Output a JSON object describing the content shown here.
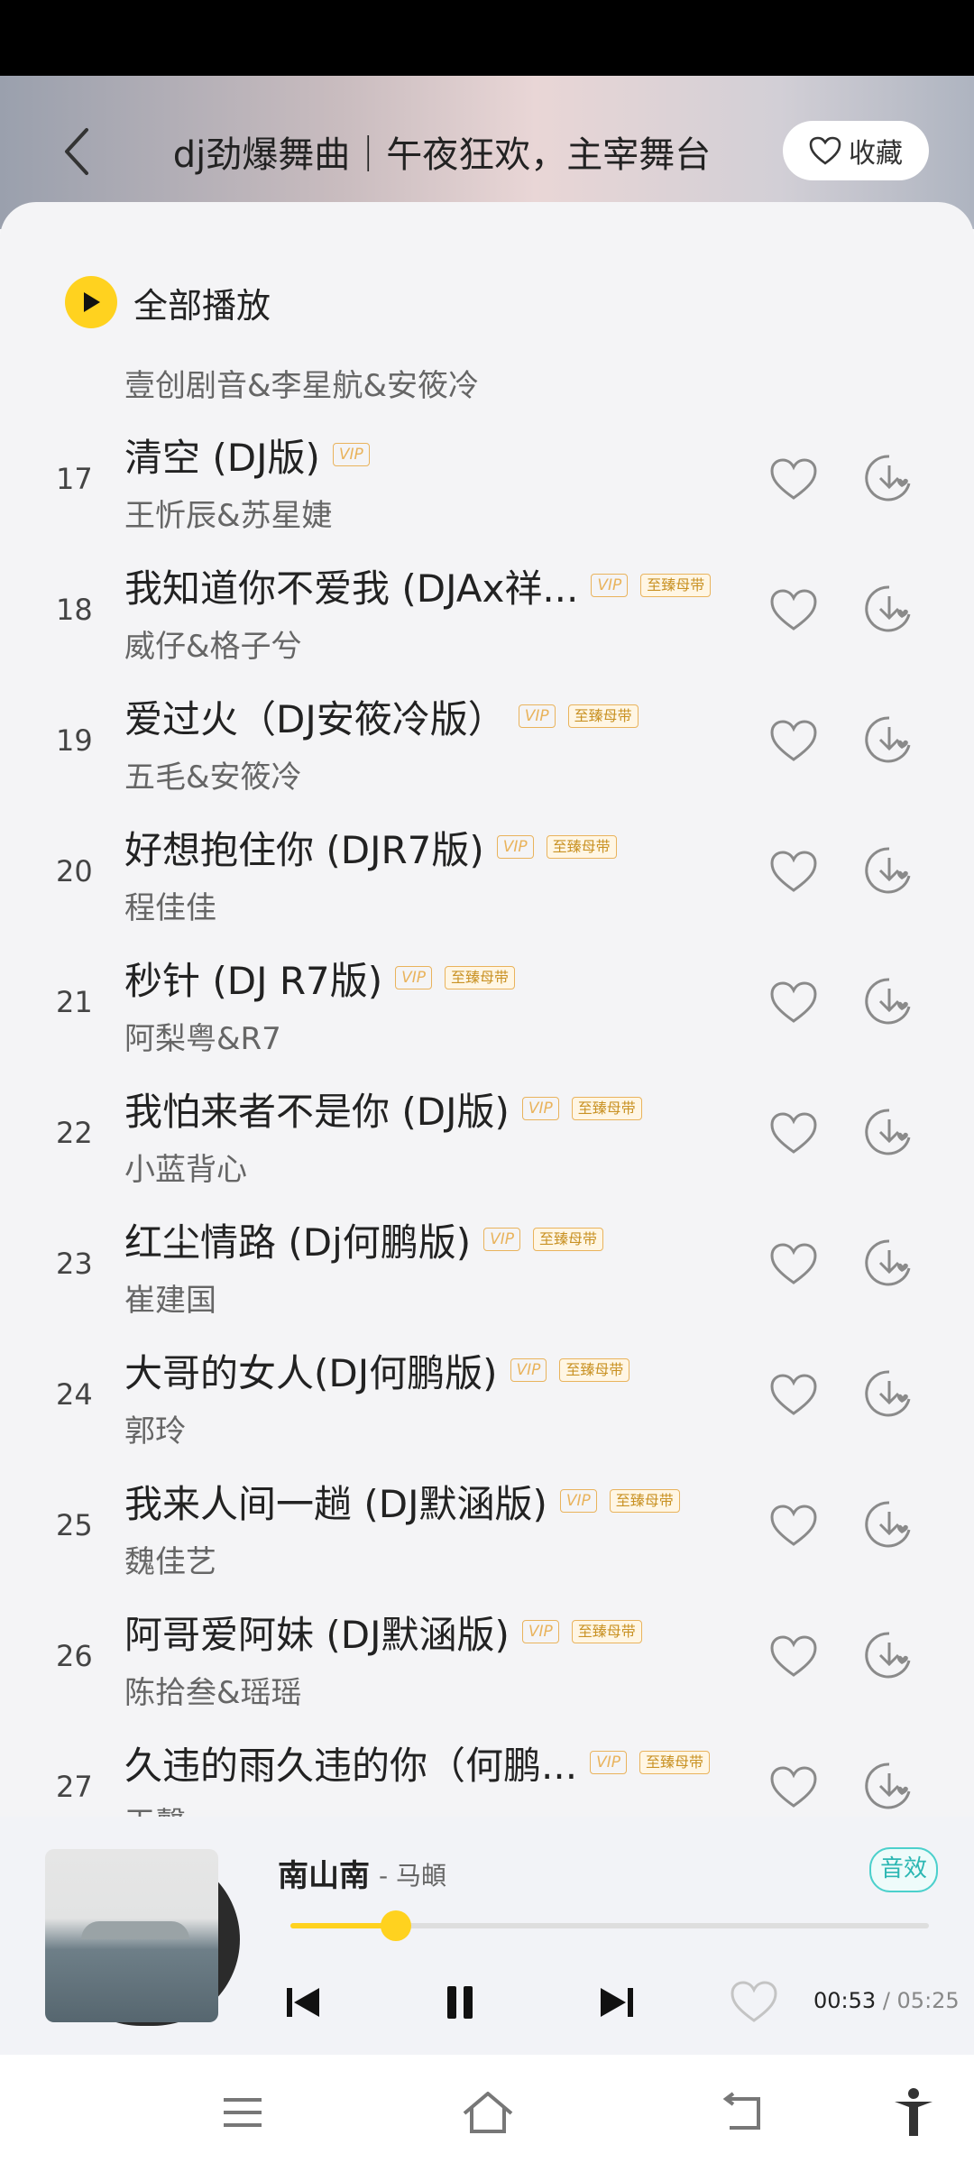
{
  "header": {
    "title": "dj劲爆舞曲｜午夜狂欢，主宰舞台",
    "favorite_label": "收藏"
  },
  "playall": {
    "label": "全部播放"
  },
  "previous_artist": "壹创剧音&李星航&安筱冷",
  "tags": {
    "vip": "VIP",
    "master": "至臻母带"
  },
  "songs": [
    {
      "index": "17",
      "title": "清空 (DJ版)",
      "artist": "王忻辰&苏星婕",
      "vip": true,
      "master": false
    },
    {
      "index": "18",
      "title": "我知道你不爱我 (DJAx祥...",
      "artist": "威仔&格子兮",
      "vip": true,
      "master": true
    },
    {
      "index": "19",
      "title": "爱过火（DJ安筱冷版）",
      "artist": "五毛&安筱冷",
      "vip": true,
      "master": true
    },
    {
      "index": "20",
      "title": "好想抱住你 (DJR7版)",
      "artist": "程佳佳",
      "vip": true,
      "master": true
    },
    {
      "index": "21",
      "title": "秒针 (DJ R7版)",
      "artist": "阿梨粤&R7",
      "vip": true,
      "master": true
    },
    {
      "index": "22",
      "title": "我怕来者不是你 (DJ版)",
      "artist": "小蓝背心",
      "vip": true,
      "master": true
    },
    {
      "index": "23",
      "title": "红尘情路 (Dj何鹏版)",
      "artist": "崔建国",
      "vip": true,
      "master": true
    },
    {
      "index": "24",
      "title": "大哥的女人(DJ何鹏版)",
      "artist": "郭玲",
      "vip": true,
      "master": true
    },
    {
      "index": "25",
      "title": "我来人间一趟 (DJ默涵版)",
      "artist": "魏佳艺",
      "vip": true,
      "master": true
    },
    {
      "index": "26",
      "title": "阿哥爱阿妹 (DJ默涵版)",
      "artist": "陈拾叁&瑶瑶",
      "vip": true,
      "master": true
    },
    {
      "index": "27",
      "title": "久违的雨久违的你（何鹏...",
      "artist": "王馨",
      "vip": true,
      "master": true
    }
  ],
  "player": {
    "title": "南山南",
    "artist": "- 马頔",
    "effect_label": "音效",
    "current_time": "00:53",
    "total_time": "/ 05:25",
    "progress": 0.165
  },
  "colors": {
    "accent": "#ffd21f",
    "tag": "#e9b35c",
    "effect": "#2cb7b3"
  }
}
